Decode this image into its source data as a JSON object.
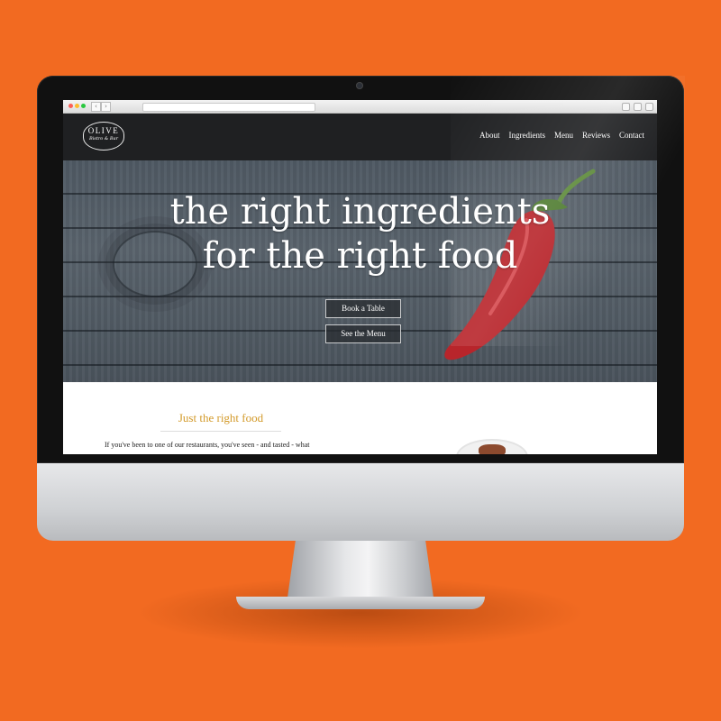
{
  "browser": {
    "back_label": "‹",
    "forward_label": "›"
  },
  "site": {
    "logo": {
      "line1": "OLIVE",
      "line2": "Bistro & Bar"
    },
    "nav": [
      "About",
      "Ingredients",
      "Menu",
      "Reviews",
      "Contact"
    ]
  },
  "hero": {
    "title_line1": "the right ingredients",
    "title_line2": "for the right food",
    "buttons": [
      "Book a Table",
      "See the Menu"
    ]
  },
  "section": {
    "title": "Just the right food",
    "paragraph": "If you've been to one of our restaurants, you've seen - and tasted - what"
  },
  "colors": {
    "background": "#f26a21",
    "accent_gold": "#d39a2a",
    "header": "#1f2022",
    "pepper_red": "#b8252b"
  }
}
